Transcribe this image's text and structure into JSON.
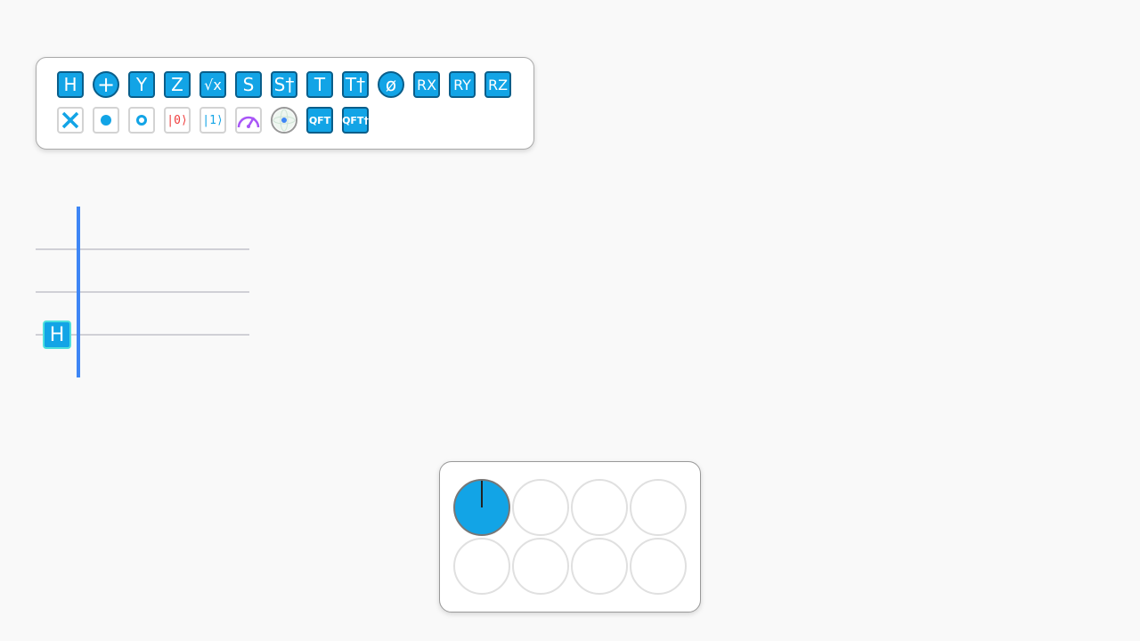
{
  "toolbar": {
    "row1": [
      {
        "label": "H",
        "name": "hadamard"
      },
      {
        "label": "+",
        "name": "cnot"
      },
      {
        "label": "Y",
        "name": "pauli-y"
      },
      {
        "label": "Z",
        "name": "pauli-z"
      },
      {
        "label": "√x",
        "name": "sqrt-x"
      },
      {
        "label": "S",
        "name": "s"
      },
      {
        "label": "S†",
        "name": "s-dagger"
      },
      {
        "label": "T",
        "name": "t"
      },
      {
        "label": "T†",
        "name": "t-dagger"
      },
      {
        "label": "ø",
        "name": "phase"
      },
      {
        "label": "RX",
        "name": "rx"
      },
      {
        "label": "RY",
        "name": "ry"
      },
      {
        "label": "RZ",
        "name": "rz"
      }
    ],
    "row2": [
      {
        "label": "",
        "name": "swap"
      },
      {
        "label": "",
        "name": "control"
      },
      {
        "label": "",
        "name": "anti-control"
      },
      {
        "label": "|0⟩",
        "name": "init-zero"
      },
      {
        "label": "|1⟩",
        "name": "init-one"
      },
      {
        "label": "",
        "name": "measure"
      },
      {
        "label": "",
        "name": "bloch"
      },
      {
        "label": "QFT",
        "name": "qft"
      },
      {
        "label": "QFT†",
        "name": "qft-dagger"
      }
    ]
  },
  "circuit": {
    "qubits": 3,
    "placed_gate": {
      "label": "H",
      "qubit": 2
    }
  },
  "amplitudes": {
    "values": [
      1,
      0,
      0,
      0,
      0,
      0,
      0,
      0
    ]
  },
  "colors": {
    "accent": "#12a4e6",
    "bar": "#3e86f5",
    "wire": "#d0d0d6"
  }
}
